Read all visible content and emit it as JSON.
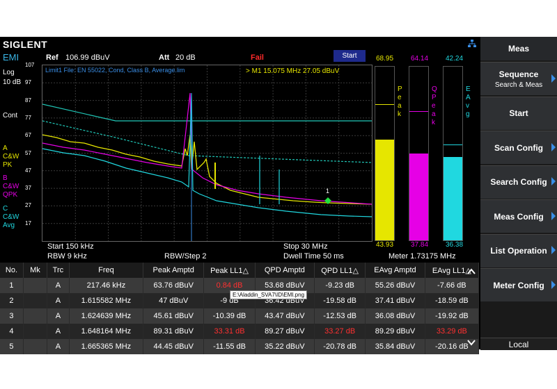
{
  "brand": "SIGLENT",
  "mode": "EMI",
  "header": {
    "ref_label": "Ref",
    "ref_value": "106.99 dBuV",
    "att_label": "Att",
    "att_value": "20 dB",
    "status": "Fail",
    "start_button": "Start"
  },
  "left_panel": {
    "scale_type": "Log",
    "scale_div": "10 dB",
    "cont": "Cont",
    "trace_a": [
      "A",
      "C&W",
      "PK"
    ],
    "trace_b": [
      "B",
      "C&W",
      "QPK"
    ],
    "trace_c": [
      "C",
      "C&W",
      "Avg"
    ]
  },
  "plot": {
    "limit_text": "Limit1 File: EN 55022, Cond, Class B, Average.lim",
    "marker_text": "> M1   15.075 MHz   27.05 dBuV",
    "marker_label": "1",
    "y_ticks": [
      "107",
      "97",
      "87",
      "77",
      "67",
      "57",
      "47",
      "37",
      "27",
      "17"
    ],
    "start": "Start  150 kHz",
    "rbw": "RBW 9 kHz",
    "rbw_step": "RBW/Step    2",
    "stop": "Stop  30 MHz",
    "dwell": "Dwell Time   50 ms"
  },
  "meters": {
    "peak": {
      "value": "68.95",
      "vertical": "Peak",
      "bottom": "43.93",
      "color": "#e6e600",
      "level": 0.58,
      "hold": 0.78
    },
    "qpeak": {
      "value": "64.14",
      "vertical": "QPeak",
      "bottom": "37.84",
      "color": "#e600e6",
      "level": 0.5,
      "hold": 0.74
    },
    "eavg": {
      "value": "42.24",
      "vertical": "EAvg",
      "bottom": "36.38",
      "color": "#20d8e0",
      "level": 0.48,
      "hold": 0.55
    },
    "meter_text": "Meter  1.73175 MHz"
  },
  "softkeys": {
    "title": "Meas",
    "items": [
      {
        "label": "Sequence",
        "sub": "Search & Meas",
        "arrow": true
      },
      {
        "label": "Start",
        "sub": "",
        "arrow": false
      },
      {
        "label": "Scan Config",
        "sub": "",
        "arrow": true
      },
      {
        "label": "Search Config",
        "sub": "",
        "arrow": true
      },
      {
        "label": "Meas Config",
        "sub": "",
        "arrow": true
      },
      {
        "label": "List Operation",
        "sub": "",
        "arrow": true
      },
      {
        "label": "Meter Config",
        "sub": "",
        "arrow": true
      }
    ],
    "local": "Local"
  },
  "table": {
    "headers": [
      "No.",
      "Mk",
      "Trc",
      "Freq",
      "Peak Amptd",
      "Peak LL1△",
      "QPD Amptd",
      "QPD LL1△",
      "EAvg Amptd",
      "EAvg LL1△"
    ],
    "rows": [
      [
        "1",
        "",
        "A",
        "217.46 kHz",
        "63.76 dBuV",
        "0.84 dB",
        "53.68 dBuV",
        "-9.23 dB",
        "55.26 dBuV",
        "-7.66 dB"
      ],
      [
        "2",
        "",
        "A",
        "1.615582 MHz",
        "47 dBuV",
        "-9 dB",
        "36.42 dBuV",
        "-19.58 dB",
        "37.41 dBuV",
        "-18.59 dB"
      ],
      [
        "3",
        "",
        "A",
        "1.624639 MHz",
        "45.61 dBuV",
        "-10.39 dB",
        "43.47 dBuV",
        "-12.53 dB",
        "36.08 dBuV",
        "-19.92 dB"
      ],
      [
        "4",
        "",
        "A",
        "1.648164 MHz",
        "89.31 dBuV",
        "33.31 dB",
        "89.27 dBuV",
        "33.27 dB",
        "89.29 dBuV",
        "33.29 dB"
      ],
      [
        "5",
        "",
        "A",
        "1.665365 MHz",
        "44.45 dBuV",
        "-11.55 dB",
        "35.22 dBuV",
        "-20.78 dB",
        "35.84 dBuV",
        "-20.16 dB"
      ]
    ],
    "red_cells": [
      [
        0,
        5
      ],
      [
        3,
        5
      ],
      [
        3,
        7
      ],
      [
        3,
        9
      ]
    ],
    "tooltip": "E:\\Aladdin_SVA7\\ID\\EMI.png"
  }
}
